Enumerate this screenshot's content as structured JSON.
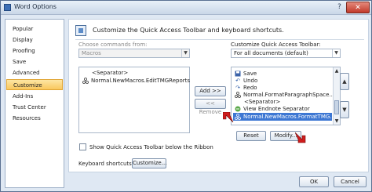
{
  "window": {
    "title": "Word Options",
    "help_label": "?",
    "close_label": "✕"
  },
  "nav": {
    "items": [
      {
        "label": "Popular"
      },
      {
        "label": "Display"
      },
      {
        "label": "Proofing"
      },
      {
        "label": "Save"
      },
      {
        "label": "Advanced"
      },
      {
        "label": "Customize"
      },
      {
        "label": "Add-Ins"
      },
      {
        "label": "Trust Center"
      },
      {
        "label": "Resources"
      }
    ],
    "selected": "Customize"
  },
  "content": {
    "header": "Customize the Quick Access Toolbar and keyboard shortcuts.",
    "choose_label": "Choose commands from:",
    "choose_value": "Macros",
    "customize_label": "Customize Quick Access Toolbar:",
    "customize_value": "For all documents (default)",
    "left_list": [
      {
        "label": "<Separator>",
        "icon": ""
      },
      {
        "label": "Normal.NewMacros.EditTMGReports",
        "icon": "macro-icon"
      }
    ],
    "right_list": [
      {
        "label": "Save",
        "icon": "save-icon"
      },
      {
        "label": "Undo",
        "icon": "undo-icon"
      },
      {
        "label": "Redo",
        "icon": "redo-icon"
      },
      {
        "label": "Normal.FormatParagraphSpace...",
        "icon": "macro-icon"
      },
      {
        "label": "<Separator>",
        "icon": ""
      },
      {
        "label": "View Endnote Separator",
        "icon": "endnote-icon"
      },
      {
        "label": "Normal.NewMacros.FormatTMG...",
        "icon": "macro-icon",
        "selected": true
      }
    ],
    "add_label": "Add >>",
    "remove_label": "<< Remove",
    "reset_label": "Reset",
    "modify_label": "Modify...",
    "show_qat_label": "Show Quick Access Toolbar below the Ribbon",
    "show_qat_checked": false,
    "keyboard_label": "Keyboard shortcuts:",
    "keyboard_button": "Customize..."
  },
  "footer": {
    "ok_label": "OK",
    "cancel_label": "Cancel"
  },
  "colors": {
    "selection": "#3d77d3",
    "nav_selected": "#f9c75e",
    "annotation_arrow": "#d01c1c"
  }
}
